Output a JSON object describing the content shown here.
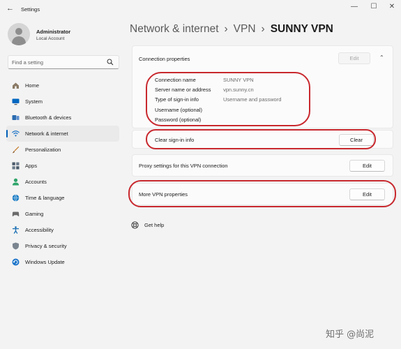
{
  "window": {
    "title": "Settings",
    "controls": [
      "—",
      "☐",
      "✕"
    ]
  },
  "profile": {
    "name": "Administrator",
    "account_type": "Local Account"
  },
  "search": {
    "placeholder": "Find a setting"
  },
  "sidebar": {
    "items": [
      {
        "label": "Home",
        "icon": "home-icon",
        "color": "#7a6a55"
      },
      {
        "label": "System",
        "icon": "system-icon",
        "color": "#0067c0"
      },
      {
        "label": "Bluetooth & devices",
        "icon": "bluetooth-icon",
        "color": "#2b6cb0"
      },
      {
        "label": "Network & internet",
        "icon": "network-icon",
        "color": "#1a73c8"
      },
      {
        "label": "Personalization",
        "icon": "brush-icon",
        "color": "#c77b2a"
      },
      {
        "label": "Apps",
        "icon": "apps-icon",
        "color": "#4a5a6a"
      },
      {
        "label": "Accounts",
        "icon": "accounts-icon",
        "color": "#2ea46a"
      },
      {
        "label": "Time & language",
        "icon": "globe-icon",
        "color": "#1f7fc4"
      },
      {
        "label": "Gaming",
        "icon": "gaming-icon",
        "color": "#6b6b6b"
      },
      {
        "label": "Accessibility",
        "icon": "accessibility-icon",
        "color": "#1a6fb3"
      },
      {
        "label": "Privacy & security",
        "icon": "shield-icon",
        "color": "#6f7a86"
      },
      {
        "label": "Windows Update",
        "icon": "update-icon",
        "color": "#1c75c9"
      }
    ],
    "active_index": 3
  },
  "breadcrumb": {
    "parent": "Network & internet",
    "middle": "VPN",
    "current": "SUNNY VPN",
    "separator": "›"
  },
  "connection_properties": {
    "title": "Connection properties",
    "edit_label": "Edit",
    "rows": [
      {
        "label": "Connection name",
        "value": "SUNNY VPN"
      },
      {
        "label": "Server name or address",
        "value": "vpn.sunny.cn"
      },
      {
        "label": "Type of sign-in info",
        "value": "Username and password"
      },
      {
        "label": "Username (optional)",
        "value": ""
      },
      {
        "label": "Password (optional)",
        "value": ""
      }
    ]
  },
  "clear_signin": {
    "label": "Clear sign-in info",
    "button": "Clear"
  },
  "proxy": {
    "label": "Proxy settings for this VPN connection",
    "button": "Edit"
  },
  "more_vpn": {
    "label": "More VPN properties",
    "button": "Edit"
  },
  "help": {
    "label": "Get help"
  },
  "watermark": "知乎 @尚泥",
  "accent_color": "#005fb8",
  "annotation_color": "#c8282e"
}
